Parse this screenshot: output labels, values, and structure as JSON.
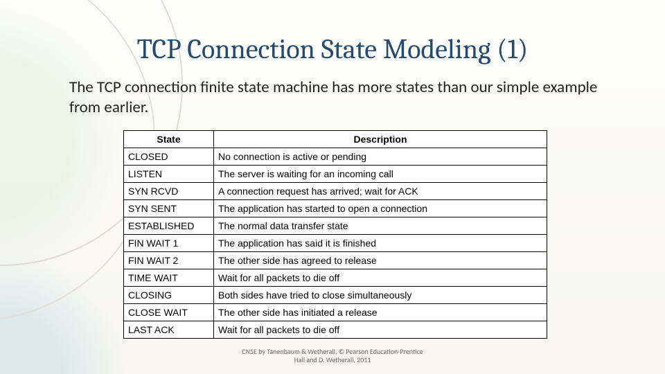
{
  "title": "TCP Connection State Modeling (1)",
  "body_text": "The TCP connection finite state machine has more states than our simple example from earlier.",
  "table": {
    "headers": [
      "State",
      "Description"
    ],
    "rows": [
      [
        "CLOSED",
        "No connection is active or pending"
      ],
      [
        "LISTEN",
        "The server is waiting for an incoming call"
      ],
      [
        "SYN RCVD",
        "A connection request has arrived; wait for ACK"
      ],
      [
        "SYN SENT",
        "The application has started to open a connection"
      ],
      [
        "ESTABLISHED",
        "The normal data transfer state"
      ],
      [
        "FIN WAIT 1",
        "The application has said it is finished"
      ],
      [
        "FIN WAIT 2",
        "The other side has agreed to release"
      ],
      [
        "TIME WAIT",
        "Wait for all packets to die off"
      ],
      [
        "CLOSING",
        "Both sides have tried to close simultaneously"
      ],
      [
        "CLOSE WAIT",
        "The other side has initiated a release"
      ],
      [
        "LAST ACK",
        "Wait for all packets to die off"
      ]
    ]
  },
  "footer_line1": "CN5E by Tanenbaum & Wetherall, © Pearson Education-Prentice",
  "footer_line2": "Hall and D. Wetherall, 2011"
}
